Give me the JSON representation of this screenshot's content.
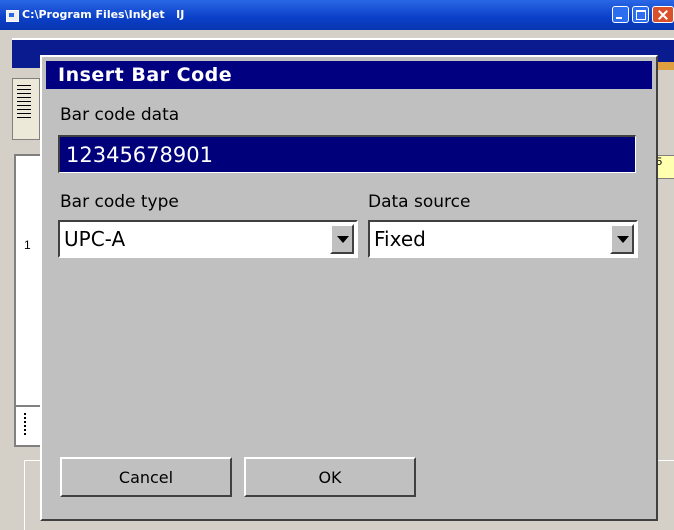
{
  "outer_window": {
    "title": "C:\\Program Files\\InkJet   IJ"
  },
  "background_app": {
    "row_number": "1",
    "cell_value": "5"
  },
  "dialog": {
    "title": "Insert Bar Code",
    "barcode_data_label": "Bar code data",
    "barcode_data_value": "12345678901",
    "barcode_type_label": "Bar code type",
    "barcode_type_value": "UPC-A",
    "data_source_label": "Data source",
    "data_source_value": "Fixed",
    "cancel_label": "Cancel",
    "ok_label": "OK"
  },
  "icons": [
    "app-icon",
    "minimize-icon",
    "maximize-icon",
    "close-icon",
    "chevron-down-icon"
  ],
  "colors": {
    "dialog_title_bg": "#000080",
    "selected_field_bg": "#00007b",
    "dialog_bg": "#c0c0c0"
  }
}
